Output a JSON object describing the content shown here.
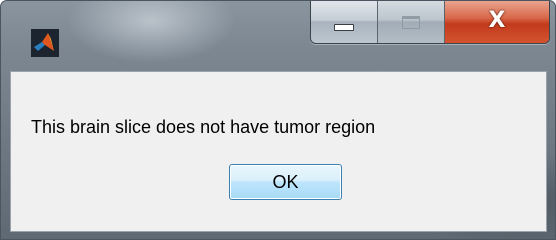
{
  "window": {
    "icon": "matlab-icon",
    "controls": {
      "minimize_icon": "minimize-icon",
      "maximize_icon": "maximize-icon",
      "close_glyph": "X"
    }
  },
  "dialog": {
    "message": "This brain slice does not have tumor region",
    "ok_label": "OK"
  },
  "colors": {
    "close_button": "#c23a1c",
    "ok_button_border": "#3c7fb1",
    "client_background": "#f0f0f0"
  }
}
